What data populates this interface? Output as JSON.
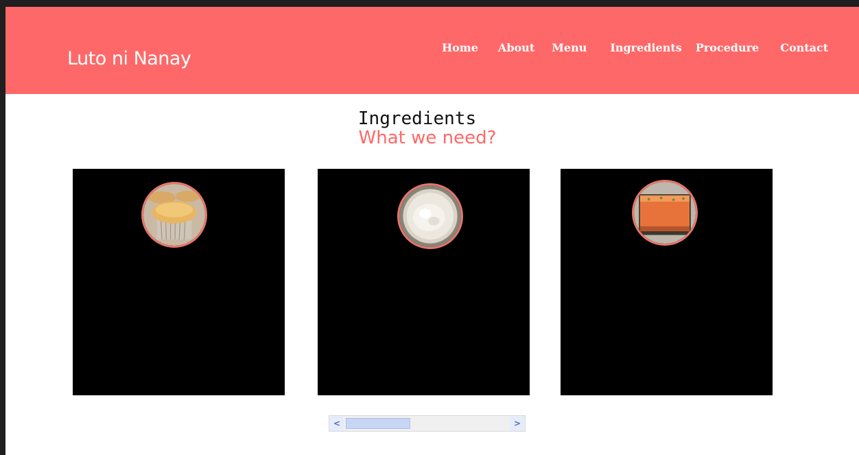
{
  "brand": "Luto ni Nanay",
  "nav": {
    "home": "Home",
    "about": "About",
    "menu": "Menu",
    "ingredients": "Ingredients",
    "procedure": "Procedure",
    "contact": "Contact"
  },
  "section": {
    "title": "Ingredients",
    "subtitle": "What we need?"
  },
  "cards": [
    {
      "image": "muffin-image"
    },
    {
      "image": "rice-bowl-image"
    },
    {
      "image": "orange-cake-image"
    }
  ],
  "scrollbar": {
    "left_arrow": "<",
    "right_arrow": ">"
  },
  "colors": {
    "accent": "#ff6868",
    "card_bg": "#000000",
    "thumb_border": "#e8766a"
  }
}
